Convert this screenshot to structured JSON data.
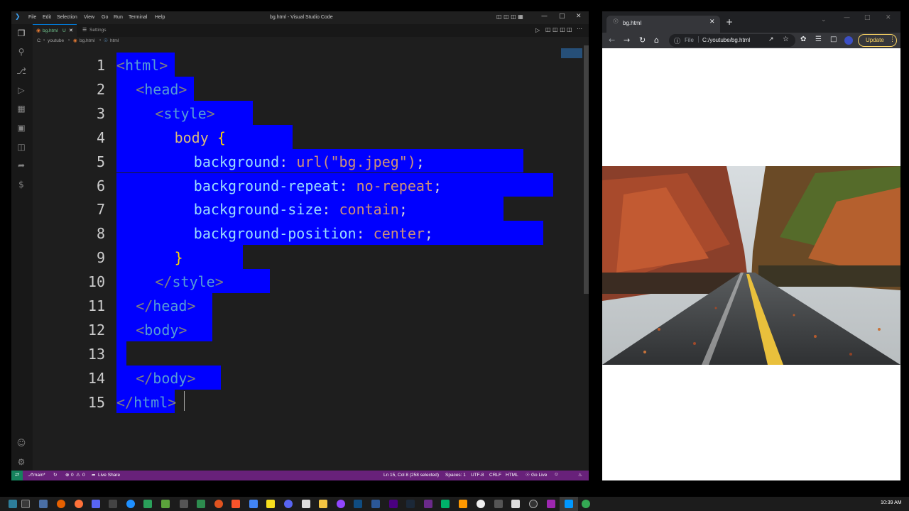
{
  "vscode": {
    "menu": [
      "File",
      "Edit",
      "Selection",
      "View",
      "Go",
      "Run",
      "Terminal",
      "Help"
    ],
    "window_title": "bg.html - Visual Studio Code",
    "tabs": [
      {
        "label": "bg.html",
        "status": "U"
      },
      {
        "label": "Settings"
      }
    ],
    "breadcrumb": [
      "C:",
      "youtube",
      "bg.html",
      "html"
    ],
    "code_lines": [
      {
        "n": "1",
        "text": "<html>"
      },
      {
        "n": "2",
        "text": "<head>"
      },
      {
        "n": "3",
        "text": "<style>"
      },
      {
        "n": "4",
        "text": "body {"
      },
      {
        "n": "5",
        "text": "background: url(\"bg.jpeg\");"
      },
      {
        "n": "6",
        "text": "background-repeat: no-repeat;"
      },
      {
        "n": "7",
        "text": "background-size: contain;"
      },
      {
        "n": "8",
        "text": "background-position: center;"
      },
      {
        "n": "9",
        "text": "}"
      },
      {
        "n": "10",
        "text": "</style>"
      },
      {
        "n": "11",
        "text": "</head>"
      },
      {
        "n": "12",
        "text": "<body>"
      },
      {
        "n": "13",
        "text": ""
      },
      {
        "n": "14",
        "text": "</body>"
      },
      {
        "n": "15",
        "text": "</html>"
      }
    ],
    "status": {
      "branch": "main*",
      "problems": "0",
      "warnings": "0",
      "live_share": "Live Share",
      "position": "Ln 15, Col 8 (258 selected)",
      "spaces": "Spaces: 1",
      "encoding": "UTF-8",
      "eol": "CRLF",
      "language": "HTML",
      "go_live": "Go Live"
    }
  },
  "chrome": {
    "tab_title": "bg.html",
    "address_scheme": "File",
    "address": "C:/youtube/bg.html",
    "update_label": "Update"
  },
  "taskbar": {
    "time": "10:39 AM"
  },
  "colors": {
    "selection": "#0000ff",
    "status_bar": "#68217a",
    "update_button": "#fdd663"
  }
}
